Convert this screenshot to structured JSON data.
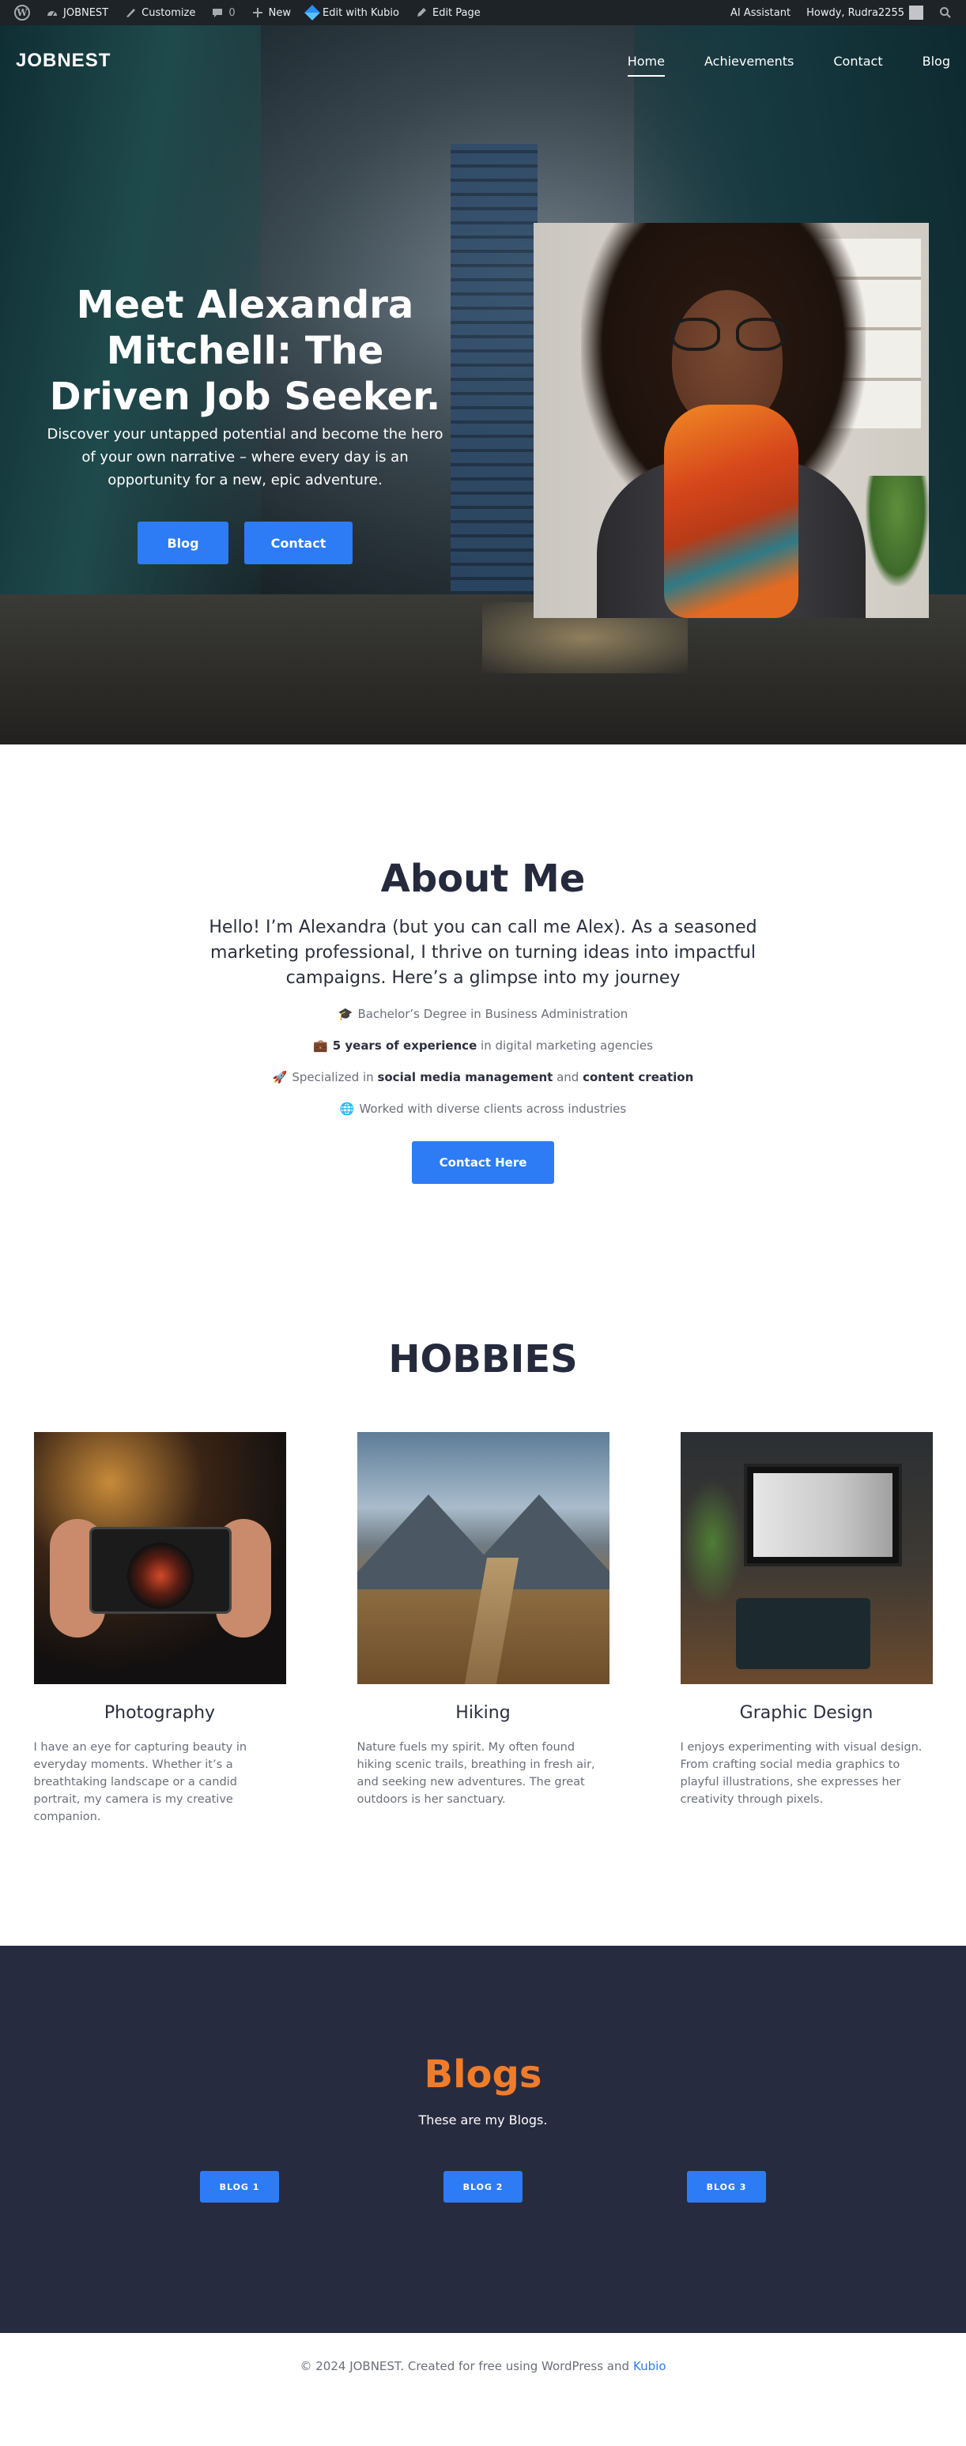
{
  "adminbar": {
    "site_name": "JOBNEST",
    "customize": "Customize",
    "comments_count": "0",
    "new": "New",
    "edit_kubio": "Edit with Kubio",
    "edit_page": "Edit Page",
    "ai_assistant": "AI Assistant",
    "howdy": "Howdy, Rudra2255"
  },
  "nav": {
    "logo": "JOBNEST",
    "items": [
      "Home",
      "Achievements",
      "Contact",
      "Blog"
    ]
  },
  "hero": {
    "title": "Meet Alexandra Mitchell: The Driven Job Seeker.",
    "subtitle": "Discover your untapped potential and become the hero of your own narrative – where every day is an opportunity for a new, epic adventure.",
    "blog_button": "Blog",
    "contact_button": "Contact"
  },
  "about": {
    "title": "About Me",
    "intro": "Hello! I’m Alexandra (but you can call me Alex). As a seasoned marketing professional, I thrive on turning ideas into impactful campaigns. Here’s a glimpse into my journey",
    "fact1_icon": "🎓",
    "fact1": "Bachelor’s Degree in Business Administration",
    "fact2_icon": "💼",
    "fact2_bold": "5 years of experience",
    "fact2_rest": " in digital marketing agencies",
    "fact3_icon": "🚀",
    "fact3_a": "Specialized in ",
    "fact3_bold1": "social media management",
    "fact3_b": " and ",
    "fact3_bold2": "content creation",
    "fact4_icon": "🌐",
    "fact4": "Worked with diverse clients across industries",
    "button": "Contact Here"
  },
  "hobbies": {
    "title": "HOBBIES",
    "items": [
      {
        "title": "Photography",
        "text": "I have an eye for capturing beauty in everyday moments. Whether it’s a breathtaking landscape or a candid portrait, my camera is my creative companion."
      },
      {
        "title": "Hiking",
        "text": "Nature fuels my spirit. My often found hiking scenic trails, breathing in fresh air, and seeking new adventures. The great outdoors is her sanctuary."
      },
      {
        "title": "Graphic Design",
        "text": "I enjoys experimenting with visual design. From crafting social media graphics to playful illustrations, she expresses her creativity through pixels."
      }
    ]
  },
  "blogs": {
    "title": "Blogs",
    "subtitle": "These are my Blogs.",
    "buttons": [
      "BLOG 1",
      "BLOG 2",
      "BLOG 3"
    ]
  },
  "footer": {
    "text": "© 2024 JOBNEST. Created for free using WordPress and",
    "link": "Kubio"
  },
  "colors": {
    "primary_button": "#2d7cf6",
    "blogs_background": "#272b3f",
    "blogs_title": "#f07c2a",
    "adminbar": "#1d2327"
  }
}
